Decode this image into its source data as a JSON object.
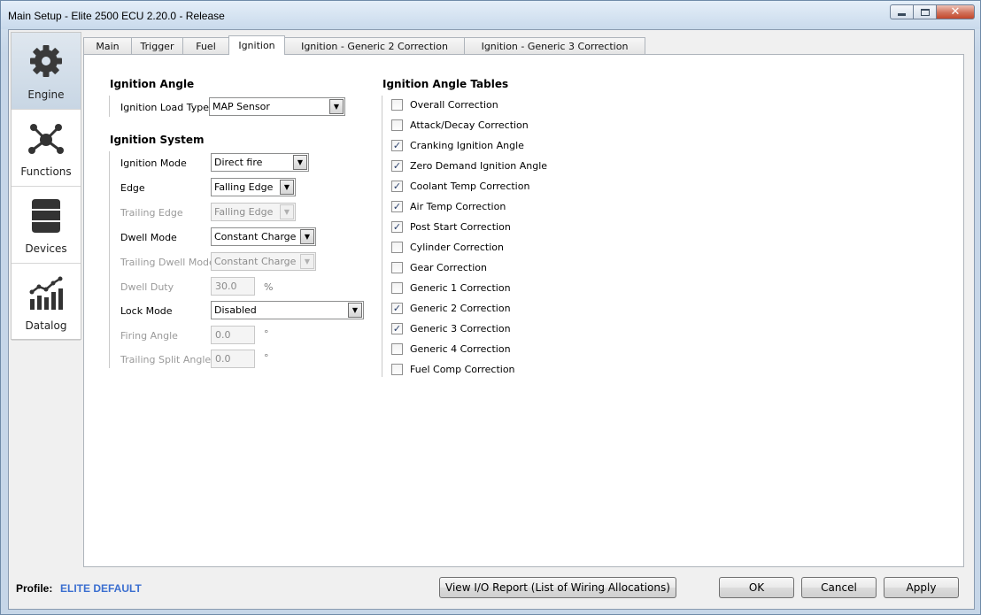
{
  "window": {
    "title": "Main Setup - Elite 2500 ECU 2.20.0 - Release"
  },
  "sidebar": {
    "items": [
      {
        "label": "Engine",
        "icon": "gear-icon",
        "active": true
      },
      {
        "label": "Functions",
        "icon": "network-icon",
        "active": false
      },
      {
        "label": "Devices",
        "icon": "database-icon",
        "active": false
      },
      {
        "label": "Datalog",
        "icon": "bar-chart-icon",
        "active": false
      }
    ]
  },
  "tabs": [
    {
      "label": "Main"
    },
    {
      "label": "Trigger"
    },
    {
      "label": "Fuel"
    },
    {
      "label": "Ignition",
      "active": true
    },
    {
      "label": "Ignition - Generic 2 Correction"
    },
    {
      "label": "Ignition - Generic 3 Correction"
    }
  ],
  "ignition_angle": {
    "title": "Ignition Angle",
    "load_type_label": "Ignition Load Type",
    "load_type_value": "MAP Sensor"
  },
  "ignition_system": {
    "title": "Ignition System",
    "mode_label": "Ignition Mode",
    "mode_value": "Direct fire",
    "edge_label": "Edge",
    "edge_value": "Falling Edge",
    "trailing_edge_label": "Trailing Edge",
    "trailing_edge_value": "Falling Edge",
    "dwell_mode_label": "Dwell Mode",
    "dwell_mode_value": "Constant Charge",
    "trailing_dwell_mode_label": "Trailing Dwell Mode",
    "trailing_dwell_mode_value": "Constant Charge",
    "dwell_duty_label": "Dwell Duty",
    "dwell_duty_value": "30.0",
    "dwell_duty_unit": "%",
    "lock_mode_label": "Lock Mode",
    "lock_mode_value": "Disabled",
    "firing_angle_label": "Firing Angle",
    "firing_angle_value": "0.0",
    "firing_angle_unit": "°",
    "trailing_split_label": "Trailing Split Angle",
    "trailing_split_value": "0.0",
    "trailing_split_unit": "°"
  },
  "tables": {
    "title": "Ignition Angle Tables",
    "items": [
      {
        "label": "Overall Correction",
        "checked": false
      },
      {
        "label": "Attack/Decay Correction",
        "checked": false
      },
      {
        "label": "Cranking Ignition Angle",
        "checked": true
      },
      {
        "label": "Zero Demand Ignition Angle",
        "checked": true
      },
      {
        "label": "Coolant Temp Correction",
        "checked": true
      },
      {
        "label": "Air Temp Correction",
        "checked": true
      },
      {
        "label": "Post Start Correction",
        "checked": true
      },
      {
        "label": "Cylinder Correction",
        "checked": false
      },
      {
        "label": "Gear Correction",
        "checked": false
      },
      {
        "label": "Generic 1 Correction",
        "checked": false
      },
      {
        "label": "Generic 2 Correction",
        "checked": true
      },
      {
        "label": "Generic 3 Correction",
        "checked": true
      },
      {
        "label": "Generic 4 Correction",
        "checked": false
      },
      {
        "label": "Fuel Comp Correction",
        "checked": false
      }
    ],
    "check_glyph": "✓"
  },
  "footer": {
    "profile_label": "Profile:",
    "profile_value": "ELITE DEFAULT",
    "io_report_label": "View I/O Report (List of Wiring Allocations)",
    "ok_label": "OK",
    "cancel_label": "Cancel",
    "apply_label": "Apply"
  },
  "colors": {
    "accent": "#3b6fd0",
    "active_category": "#c8d6e4"
  }
}
